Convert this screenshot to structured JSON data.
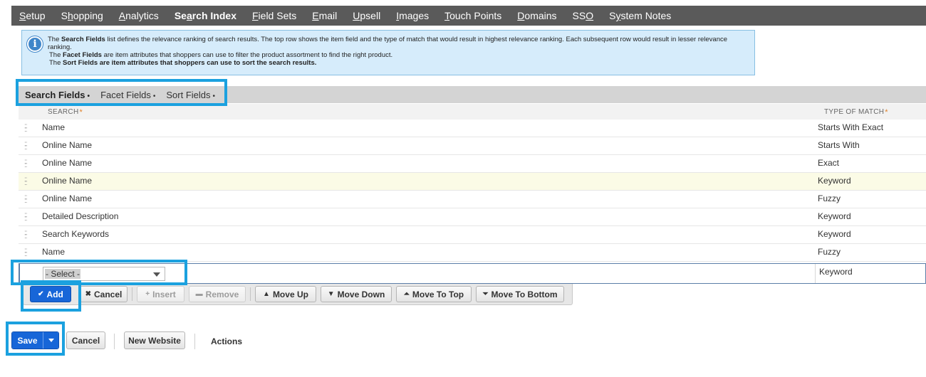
{
  "nav": {
    "items": [
      {
        "pre": "",
        "u": "S",
        "post": "etup"
      },
      {
        "pre": "S",
        "u": "h",
        "post": "opping"
      },
      {
        "pre": "",
        "u": "A",
        "post": "nalytics"
      },
      {
        "pre": "Se",
        "u": "a",
        "post": "rch Index"
      },
      {
        "pre": "",
        "u": "F",
        "post": "ield Sets"
      },
      {
        "pre": "",
        "u": "E",
        "post": "mail"
      },
      {
        "pre": "",
        "u": "U",
        "post": "psell"
      },
      {
        "pre": "",
        "u": "I",
        "post": "mages"
      },
      {
        "pre": "",
        "u": "T",
        "post": "ouch Points"
      },
      {
        "pre": "",
        "u": "D",
        "post": "omains"
      },
      {
        "pre": "SS",
        "u": "O",
        "post": ""
      },
      {
        "pre": "S",
        "u": "y",
        "post": "stem Notes"
      }
    ],
    "active_index": 3
  },
  "info": {
    "icon": "info-icon",
    "line1_pre": "The ",
    "line1_bold": "Search Fields",
    "line1_post": " list defines the relevance ranking of search results. The top row shows the item field and the type of match that would result in highest relevance ranking. Each subsequent row would result in lesser relevance",
    "line2": "ranking.",
    "line3_pre": "The ",
    "line3_bold": "Facet Fields",
    "line3_post": " are item attributes that shoppers can use to filter the product assortment to find the right product.",
    "line4_pre": "The ",
    "line4_bold": "Sort Fields are item attributes that shoppers can use to sort the search results.",
    "line4_post": ""
  },
  "subtabs": [
    {
      "label": "Search Fields",
      "bullet": "•"
    },
    {
      "label": "Facet Fields",
      "bullet": "•"
    },
    {
      "label": "Sort Fields",
      "bullet": "•"
    }
  ],
  "table": {
    "col_search": "SEARCH",
    "col_match": "TYPE OF MATCH",
    "required_mark": "*",
    "rows": [
      {
        "search": "Name",
        "match": "Starts With Exact"
      },
      {
        "search": "Online Name",
        "match": "Starts With"
      },
      {
        "search": "Online Name",
        "match": "Exact"
      },
      {
        "search": "Online Name",
        "match": "Keyword"
      },
      {
        "search": "Online Name",
        "match": "Fuzzy"
      },
      {
        "search": "Detailed Description",
        "match": "Keyword"
      },
      {
        "search": "Search Keywords",
        "match": "Keyword"
      },
      {
        "search": "Name",
        "match": "Fuzzy"
      }
    ],
    "highlight_row": 3,
    "edit_row": {
      "select_value": "- Select -",
      "match": "Keyword"
    }
  },
  "row_buttons": {
    "add": "Add",
    "cancel": "Cancel",
    "insert": "Insert",
    "remove": "Remove",
    "move_up": "Move Up",
    "move_down": "Move Down",
    "move_to_top": "Move To Top",
    "move_to_bottom": "Move To Bottom"
  },
  "footer": {
    "save": "Save",
    "cancel": "Cancel",
    "new_website": "New Website",
    "actions": "Actions"
  },
  "colors": {
    "nav_bg": "#5a5a5a",
    "primary": "#1766d8",
    "highlight_box": "#1ba1df",
    "info_bg": "#d6ecfb"
  }
}
